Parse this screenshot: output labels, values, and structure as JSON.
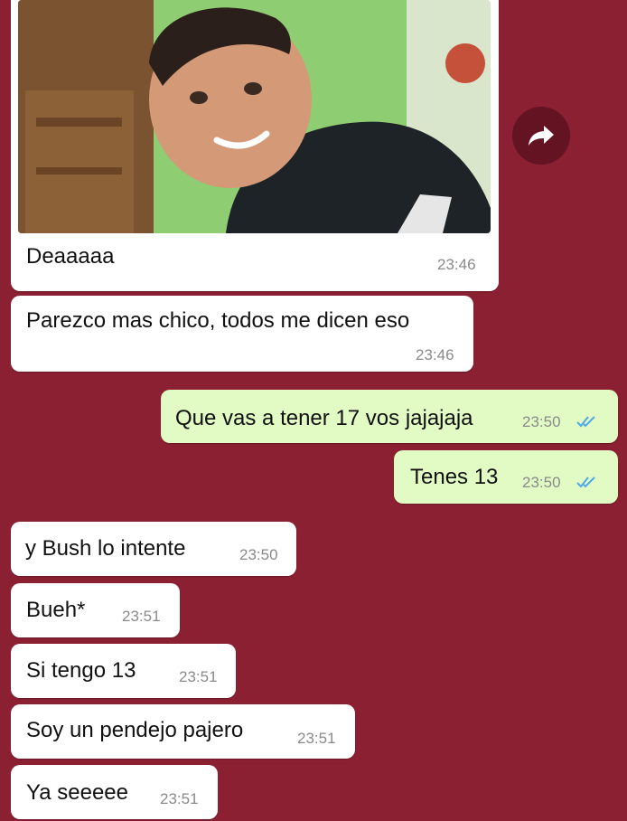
{
  "photo_message": {
    "caption": "Deaaaaa",
    "time": "23:46"
  },
  "messages": [
    {
      "direction": "in",
      "text": "Parezco mas chico, todos me dicen eso",
      "time": "23:46"
    },
    {
      "direction": "out",
      "text": "Que vas a tener 17 vos jajajaja",
      "time": "23:50",
      "status": "read-double-check-icon"
    },
    {
      "direction": "out",
      "text": "Tenes 13",
      "time": "23:50",
      "status": "read-double-check-icon"
    },
    {
      "direction": "in",
      "text": "y Bush lo intente",
      "time": "23:50"
    },
    {
      "direction": "in",
      "text": "Bueh*",
      "time": "23:51"
    },
    {
      "direction": "in",
      "text": "Si tengo 13",
      "time": "23:51"
    },
    {
      "direction": "in",
      "text": "Soy un pendejo pajero",
      "time": "23:51"
    },
    {
      "direction": "in",
      "text": "Ya seeeee",
      "time": "23:51"
    }
  ],
  "icons": {
    "forward": "share-forward-icon",
    "read_receipt": "double-check-icon"
  },
  "colors": {
    "chat_background": "#8b2033",
    "incoming_bubble": "#ffffff",
    "outgoing_bubble": "#e2fbc4",
    "read_tick": "#4fa9e6"
  }
}
